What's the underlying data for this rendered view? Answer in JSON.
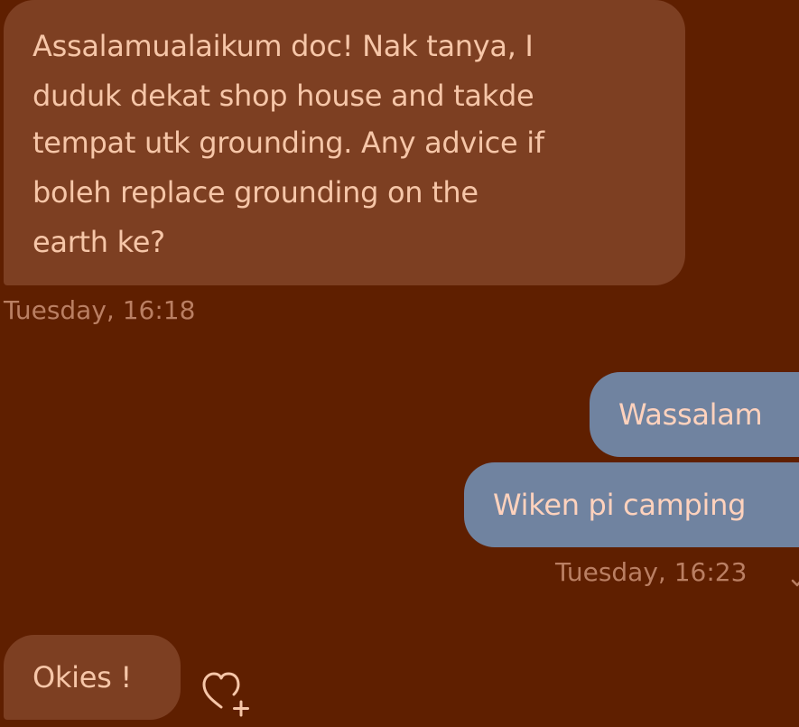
{
  "colors": {
    "background": "#5f1f00",
    "received_bubble": "#7d3f22",
    "sent_bubble": "#7083a0",
    "received_text": "#f6c6a8",
    "sent_text": "#ffd2bd",
    "timestamp_text": "#ba7f63"
  },
  "conversation": {
    "messages": [
      {
        "direction": "received",
        "lines": [
          "Assalamualaikum doc! Nak tanya, I",
          "duduk dekat shop house and takde",
          "tempat utk grounding. Any advice if",
          "boleh replace grounding on the",
          "earth ke?"
        ]
      },
      {
        "direction": "sent",
        "text": "Wassalam"
      },
      {
        "direction": "sent",
        "text": "Wiken pi camping"
      },
      {
        "direction": "received",
        "text": "Okies !"
      }
    ],
    "timestamps": [
      {
        "text": "Tuesday, 16:18",
        "side": "received"
      },
      {
        "text": "Tuesday, 16:23",
        "side": "sent",
        "status_icon": "check-icon"
      }
    ]
  },
  "icons": {
    "reaction": "heart-plus-icon",
    "delivery_status": "check-icon"
  }
}
